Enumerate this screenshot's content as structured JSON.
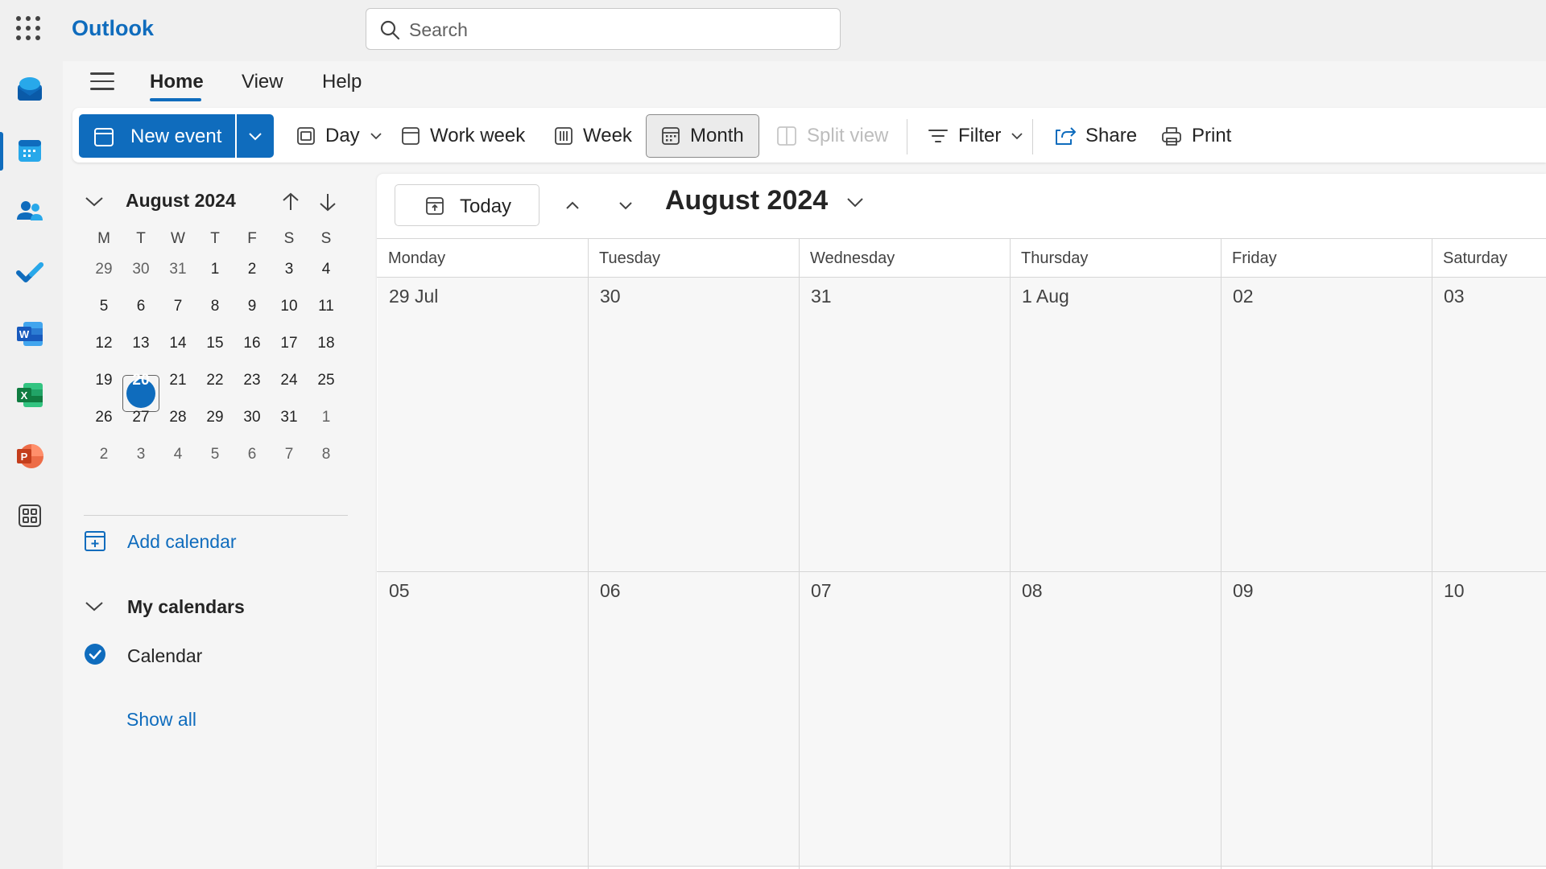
{
  "app": {
    "name": "Outlook",
    "search_placeholder": "Search"
  },
  "rail": {
    "items": [
      "mail-icon",
      "calendar-icon",
      "people-icon",
      "todo-icon",
      "word-icon",
      "excel-icon",
      "powerpoint-icon",
      "more-apps-icon"
    ],
    "active": "calendar-icon"
  },
  "tabs": [
    "Home",
    "View",
    "Help"
  ],
  "ribbon": {
    "new_event": "New event",
    "day": "Day",
    "work_week": "Work week",
    "week": "Week",
    "month": "Month",
    "split_view": "Split view",
    "filter": "Filter",
    "share": "Share",
    "print": "Print"
  },
  "mini_calendar": {
    "title": "August 2024",
    "dow": [
      "M",
      "T",
      "W",
      "T",
      "F",
      "S",
      "S"
    ],
    "weeks": [
      [
        "29",
        "30",
        "31",
        "1",
        "2",
        "3",
        "4"
      ],
      [
        "5",
        "6",
        "7",
        "8",
        "9",
        "10",
        "11"
      ],
      [
        "12",
        "13",
        "14",
        "15",
        "16",
        "17",
        "18"
      ],
      [
        "19",
        "20",
        "21",
        "22",
        "23",
        "24",
        "25"
      ],
      [
        "26",
        "27",
        "28",
        "29",
        "30",
        "31",
        "1"
      ],
      [
        "2",
        "3",
        "4",
        "5",
        "6",
        "7",
        "8"
      ]
    ],
    "today": "20"
  },
  "left_pane": {
    "add_calendar": "Add calendar",
    "my_calendars": "My calendars",
    "calendar_item": "Calendar",
    "show_all": "Show all"
  },
  "calendar": {
    "today_button": "Today",
    "title": "August 2024",
    "days_of_week": [
      "Monday",
      "Tuesday",
      "Wednesday",
      "Thursday",
      "Friday",
      "Saturday"
    ],
    "week1": [
      "29 Jul",
      "30",
      "31",
      "1 Aug",
      "02",
      "03"
    ],
    "week2": [
      "05",
      "06",
      "07",
      "08",
      "09",
      "10"
    ]
  },
  "colors": {
    "accent": "#0f6cbd",
    "chrome": "#f0f0f0"
  }
}
